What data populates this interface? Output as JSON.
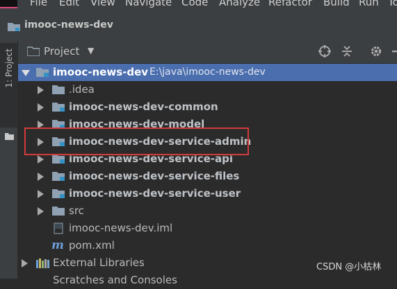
{
  "menubar": {
    "items": [
      "File",
      "Edit",
      "View",
      "Navigate",
      "Code",
      "Analyze",
      "Refactor",
      "Build",
      "Run",
      "To"
    ]
  },
  "titlebar": {
    "project_name": "imooc-news-dev"
  },
  "toolstrip": {
    "project_tab_label": "1: Project"
  },
  "panel": {
    "title": "Project"
  },
  "tree": {
    "root": {
      "name": "imooc-news-dev",
      "path": "E:\\java\\imooc-news-dev"
    },
    "items": [
      {
        "label": ".idea",
        "bold": false
      },
      {
        "label": "imooc-news-dev-common",
        "bold": true
      },
      {
        "label": "imooc-news-dev-model",
        "bold": true
      },
      {
        "label": "imooc-news-dev-service-admin",
        "bold": true
      },
      {
        "label": "imooc-news-dev-service-api",
        "bold": true
      },
      {
        "label": "imooc-news-dev-service-files",
        "bold": true
      },
      {
        "label": "imooc-news-dev-service-user",
        "bold": true
      },
      {
        "label": "src",
        "bold": false
      },
      {
        "label": "imooc-news-dev.iml",
        "bold": false
      },
      {
        "label": "pom.xml",
        "bold": false
      }
    ],
    "external_libraries": "External Libraries",
    "scratches": "Scratches and Consoles"
  },
  "watermark": "CSDN @小枯林",
  "colors": {
    "selection": "#4b6eaf",
    "module_marker": "#3592c4",
    "highlight_box": "#d23b3b"
  }
}
